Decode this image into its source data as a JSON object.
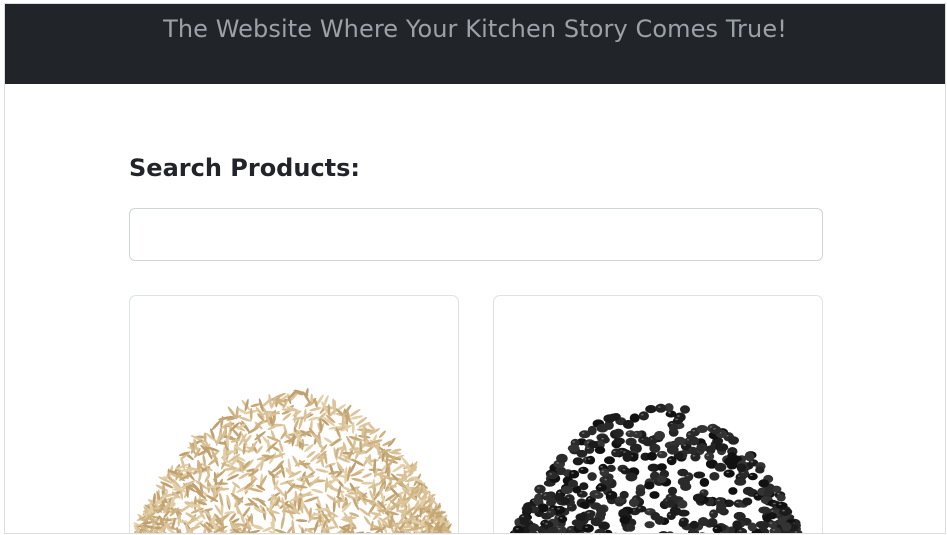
{
  "header": {
    "title": "The Website Where Your Kitchen Story Comes True!"
  },
  "search": {
    "heading": "Search Products:",
    "value": "",
    "placeholder": ""
  },
  "products": [
    {
      "image": "rice-grains-image"
    },
    {
      "image": "black-lentils-image"
    }
  ],
  "colors": {
    "header_bg": "#212529",
    "header_text": "#9ba1a7",
    "heading_text": "#212529",
    "border": "#dee2e6",
    "rice": "#d9c195",
    "lentils": "#1e1e1e"
  }
}
